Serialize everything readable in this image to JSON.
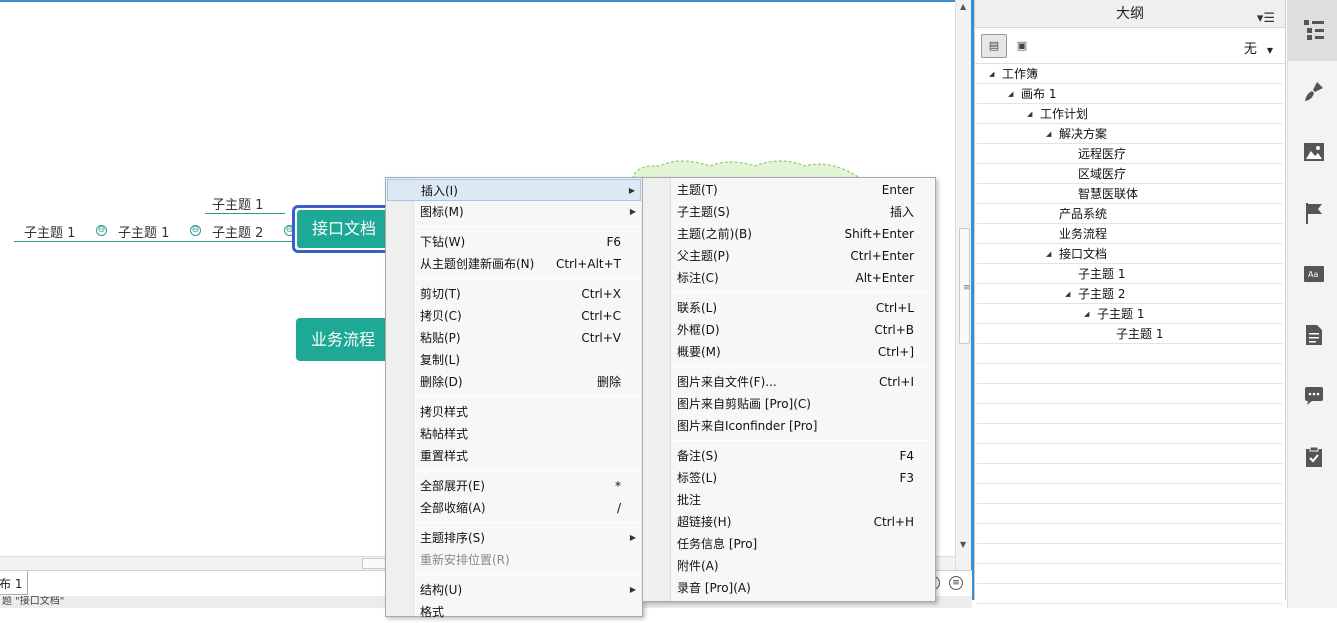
{
  "canvas": {
    "nodes": {
      "left_sub1": "子主题 1",
      "mid_sub1": "子主题 1",
      "top_sub1": "子主题 1",
      "sub2": "子主题 2",
      "main_jk": "接口文档",
      "main_yw": "业务流程",
      "collapse_glyph": "⊖"
    },
    "sheet_tab": "布 1",
    "status_text": "题 \"接口文档\"",
    "colors": {
      "topic": "#1ea896",
      "selection": "#3b5ec9",
      "accent": "#3a8fd1"
    }
  },
  "context_menu": {
    "items": [
      {
        "label": "插入(I)",
        "shortcut": "",
        "submenu": true,
        "highlight": true
      },
      {
        "label": "图标(M)",
        "shortcut": "",
        "submenu": true
      },
      {
        "label": "下钻(W)",
        "shortcut": "F6"
      },
      {
        "label": "从主题创建新画布(N)",
        "shortcut": "Ctrl+Alt+T"
      },
      {
        "label": "剪切(T)",
        "shortcut": "Ctrl+X"
      },
      {
        "label": "拷贝(C)",
        "shortcut": "Ctrl+C"
      },
      {
        "label": "粘贴(P)",
        "shortcut": "Ctrl+V"
      },
      {
        "label": "复制(L)",
        "shortcut": ""
      },
      {
        "label": "删除(D)",
        "shortcut": "删除"
      },
      {
        "label": "拷贝样式",
        "shortcut": ""
      },
      {
        "label": "粘帖样式",
        "shortcut": ""
      },
      {
        "label": "重置样式",
        "shortcut": ""
      },
      {
        "label": "全部展开(E)",
        "shortcut": "*"
      },
      {
        "label": "全部收缩(A)",
        "shortcut": "/"
      },
      {
        "label": "主题排序(S)",
        "shortcut": "",
        "submenu": true
      },
      {
        "label": "重新安排位置(R)",
        "shortcut": "",
        "disabled": true
      },
      {
        "label": "结构(U)",
        "shortcut": "",
        "submenu": true
      },
      {
        "label": "格式",
        "shortcut": ""
      }
    ]
  },
  "insert_submenu": {
    "items": [
      {
        "label": "主题(T)",
        "shortcut": "Enter"
      },
      {
        "label": "子主题(S)",
        "shortcut": "插入"
      },
      {
        "label": "主题(之前)(B)",
        "shortcut": "Shift+Enter"
      },
      {
        "label": "父主题(P)",
        "shortcut": "Ctrl+Enter"
      },
      {
        "label": "标注(C)",
        "shortcut": "Alt+Enter"
      },
      {
        "label": "联系(L)",
        "shortcut": "Ctrl+L"
      },
      {
        "label": "外框(D)",
        "shortcut": "Ctrl+B"
      },
      {
        "label": "概要(M)",
        "shortcut": "Ctrl+]"
      },
      {
        "label": "图片来自文件(F)...",
        "shortcut": "Ctrl+I"
      },
      {
        "label": "图片来自剪贴画 [Pro](C)",
        "shortcut": ""
      },
      {
        "label": "图片来自Iconfinder [Pro]",
        "shortcut": ""
      },
      {
        "label": "备注(S)",
        "shortcut": "F4"
      },
      {
        "label": "标签(L)",
        "shortcut": "F3"
      },
      {
        "label": "批注",
        "shortcut": ""
      },
      {
        "label": "超链接(H)",
        "shortcut": "Ctrl+H"
      },
      {
        "label": "任务信息 [Pro]",
        "shortcut": ""
      },
      {
        "label": "附件(A)",
        "shortcut": ""
      },
      {
        "label": "录音 [Pro](A)",
        "shortcut": ""
      }
    ]
  },
  "outline": {
    "title": "大纲",
    "filter_value": "无",
    "tree": [
      {
        "label": "工作簿",
        "expanded": true
      },
      {
        "label": "画布 1",
        "expanded": true
      },
      {
        "label": "工作计划",
        "expanded": true
      },
      {
        "label": "解决方案",
        "expanded": true
      },
      {
        "label": "远程医疗"
      },
      {
        "label": "区域医疗"
      },
      {
        "label": "智慧医联体"
      },
      {
        "label": "产品系统"
      },
      {
        "label": "业务流程"
      },
      {
        "label": "接口文档",
        "expanded": true
      },
      {
        "label": "子主题 1"
      },
      {
        "label": "子主题 2",
        "expanded": true
      },
      {
        "label": "子主题 1",
        "expanded": true
      },
      {
        "label": "子主题 1"
      }
    ]
  },
  "sidebar": {
    "icons": [
      "outline-icon",
      "format-brush-icon",
      "image-icon",
      "flag-marker-icon",
      "text-style-icon",
      "notes-icon",
      "comment-icon",
      "task-icon"
    ],
    "active": "outline-icon"
  }
}
